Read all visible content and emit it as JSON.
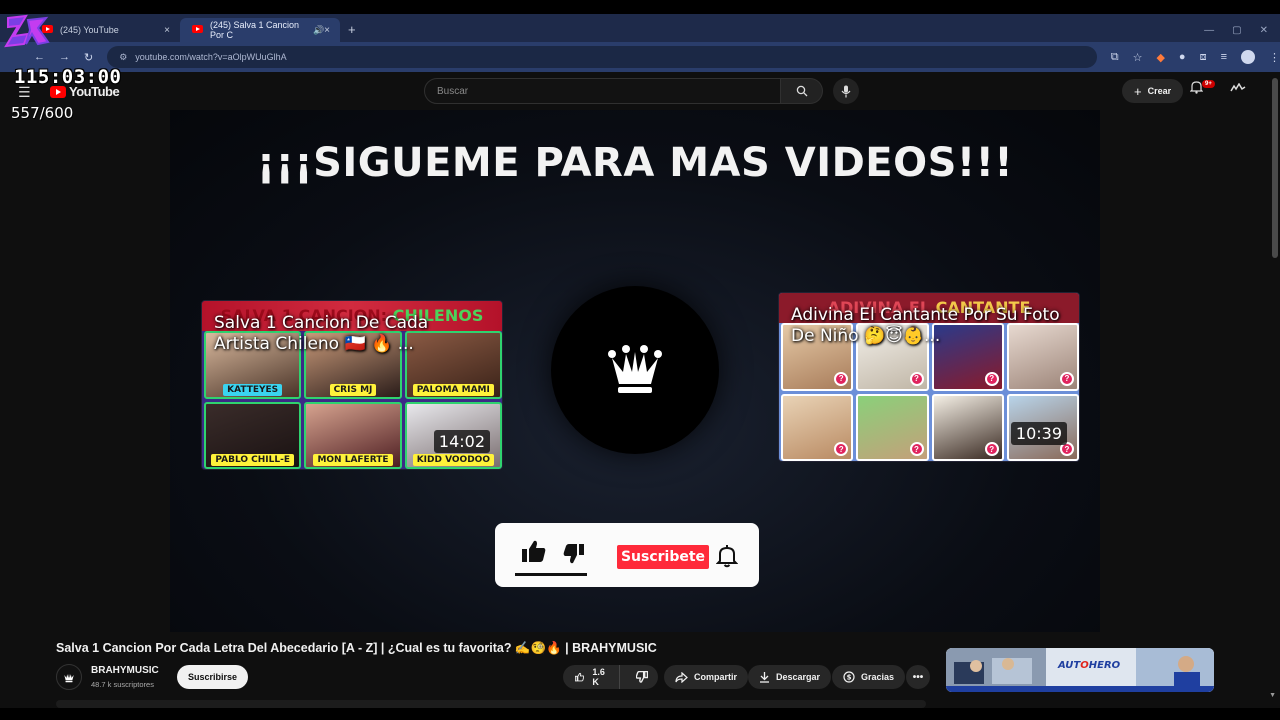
{
  "browser": {
    "tabs": [
      {
        "title": "(245) YouTube",
        "active": false
      },
      {
        "title": "(245) Salva 1 Cancion Por C",
        "active": true
      }
    ],
    "close_glyph": "×",
    "new_tab_glyph": "+",
    "url": "youtube.com/watch?v=aOlpWUuGlhA"
  },
  "overlay": {
    "timer": "115:03:00",
    "counter": "557/600",
    "logo_colors": [
      "#7b3fe4",
      "#c43cf0"
    ]
  },
  "youtube": {
    "logo_word": "YouTube",
    "search_placeholder": "Buscar",
    "create_label": "Crear",
    "notification_badge": "9+"
  },
  "end_screen": {
    "title": "¡¡¡SIGUEME PARA MAS VIDEOS!!!",
    "card_left": {
      "banner_prefix": "SALVA 1 CANCION: ",
      "banner_highlight": "CHILENOS",
      "title": "Salva 1 Cancion De Cada Artista Chileno 🇨🇱 🔥 ...",
      "duration": "14:02",
      "labels": [
        "KATTEYES",
        "CRIS MJ",
        "PALOMA MAMI",
        "PABLO CHILL-E",
        "MON LAFERTE",
        "KIDD VOODOO"
      ]
    },
    "card_right": {
      "banner_prefix": "ADIVINA EL ",
      "banner_highlight": "CANTANTE",
      "title": "Adivina El Cantante Por Su Foto De Niño 🤔😇👶...",
      "duration": "10:39",
      "question_mark": "?"
    },
    "subscribe_label": "Suscribete"
  },
  "video": {
    "title": "Salva 1 Cancion Por Cada Letra Del Abecedario [A - Z] | ¿Cual es tu favorita? ✍️🧐🔥 | BRAHYMUSIC",
    "channel_name": "BRAHYMUSIC",
    "subscriber_count": "48.7 k suscriptores",
    "subscribe_label": "Suscribirse",
    "like_count": "1.6 K",
    "share_label": "Compartir",
    "download_label": "Descargar",
    "thanks_label": "Gracias"
  },
  "ad": {
    "brand_prefix": "AUT",
    "brand_o": "O",
    "brand_suffix": "HERO"
  },
  "colors": {
    "tabstrip": "#1e2a4a",
    "addressbar": "#2a3d6b",
    "youtube_red": "#ff0000",
    "subscribe_red": "#ff2a3a",
    "bg": "#0f0f0f"
  }
}
